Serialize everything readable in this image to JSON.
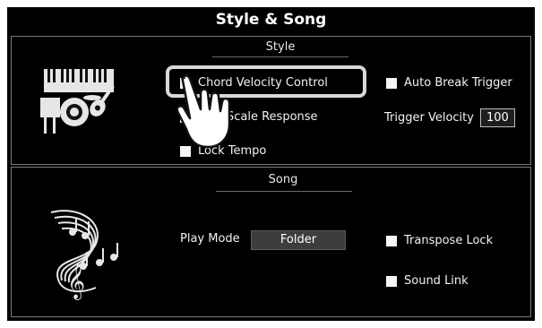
{
  "window": {
    "title": "Style & Song"
  },
  "style": {
    "title": "Style",
    "icon": "style-instruments-icon",
    "options": {
      "chord_velocity_control": "Chord Velocity Control",
      "scale_response": "Scale Response",
      "lock_tempo": "Lock Tempo",
      "auto_break_trigger": "Auto Break Trigger"
    },
    "trigger_velocity": {
      "label": "Trigger Velocity",
      "value": "100"
    }
  },
  "song": {
    "title": "Song",
    "icon": "music-notes-icon",
    "play_mode": {
      "label": "Play Mode",
      "value": "Folder"
    },
    "options": {
      "transpose_lock": "Transpose Lock",
      "sound_link": "Sound Link"
    }
  },
  "overlay": {
    "icon": "pointing-hand-icon"
  }
}
